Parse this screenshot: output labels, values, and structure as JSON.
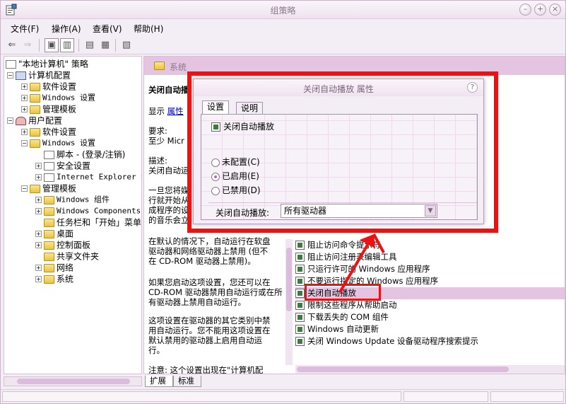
{
  "window": {
    "title": "组策略"
  },
  "menu": {
    "file": "文件(F)",
    "action": "操作(A)",
    "view": "查看(V)",
    "help": "帮助(H)"
  },
  "tree": {
    "root": "\"本地计算机\" 策略",
    "computer_config": "计算机配置",
    "cc_software": "软件设置",
    "cc_windows": "Windows 设置",
    "cc_admin": "管理模板",
    "user_config": "用户配置",
    "uc_software": "软件设置",
    "uc_windows": "Windows 设置",
    "uc_scripts": "脚本 - (登录/注销)",
    "uc_security": "安全设置",
    "uc_ie": "Internet Explorer 维",
    "uc_admin": "管理模板",
    "uc_win_components": "Windows 组件",
    "uc_win_components_en": "Windows Components",
    "uc_taskbar": "任务栏和「开始」菜单",
    "uc_desktop": "桌面",
    "uc_control_panel": "控制面板",
    "uc_shared": "共享文件夹",
    "uc_network": "网络",
    "uc_system": "系统"
  },
  "right_pane": {
    "header": "系统",
    "policy_title": "关闭自动播",
    "show_label": "显示",
    "show_link": "属性",
    "req_label": "要求:",
    "req_value": "至少 Micr",
    "desc_label": "描述:",
    "desc_first": "关闭自动运",
    "para1_lines": [
      "一旦您将媒",
      "行就开始从",
      "成程序的设",
      "的音乐会立"
    ],
    "para2_lines": [
      "在默认的情况下，自动运行在软盘",
      "驱动器和网络驱动器上禁用 (但不",
      "在 CD-ROM 驱动器上禁用)。"
    ],
    "para3_lines": [
      "如果您启动这项设置，您还可以在",
      "CD-ROM 驱动器禁用自动运行或在所",
      "有驱动器上禁用自动运行。"
    ],
    "para4_lines": [
      "这项设置在驱动器的其它类别中禁",
      "用自动运行。您不能用这项设置在",
      "默认禁用的驱动器上启用自动运",
      "行。"
    ],
    "note_line": "注意: 这个设置出现在\"计算机配"
  },
  "policy_list": [
    "阻止访问命令提示符",
    "阻止访问注册表编辑工具",
    "只运行许可的 Windows 应用程序",
    "不要运行指定的 Windows 应用程序",
    "关闭自动播放",
    "限制这些程序从帮助启动",
    "下载丢失的 COM 组件",
    "Windows 自动更新",
    "关闭 Windows Update 设备驱动程序搜索提示"
  ],
  "bottom_tabs": {
    "extended": "扩展",
    "standard": "标准"
  },
  "dialog": {
    "title": "关闭自动播放 属性",
    "tab_settings": "设置",
    "tab_explain": "说明",
    "policy_name": "关闭自动播放",
    "radio_not_configured": "未配置(C)",
    "radio_enabled": "已启用(E)",
    "radio_disabled": "已禁用(D)",
    "combo_label": "关闭自动播放:",
    "combo_value": "所有驱动器"
  },
  "colors": {
    "accent": "#e4c4e0",
    "annotation_red": "#ee1111"
  }
}
